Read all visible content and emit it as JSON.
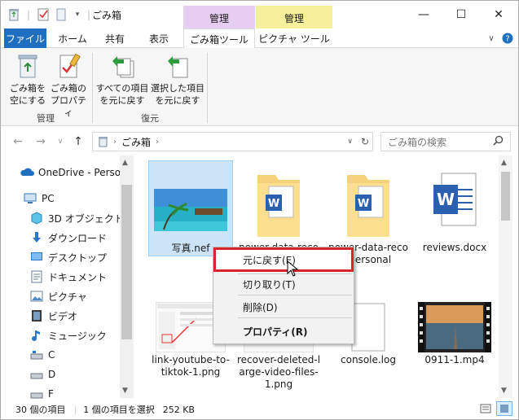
{
  "titlebar": {
    "title": "ごみ箱",
    "manage1": "管理",
    "manage2": "管理",
    "minimize": "—",
    "maximize": "☐",
    "close": "✕"
  },
  "tabs": {
    "file": "ファイル",
    "home": "ホーム",
    "share": "共有",
    "view": "表示",
    "recycle_tools": "ごみ箱ツール",
    "picture_tools": "ピクチャ ツール"
  },
  "ribbon": {
    "empty": [
      "ごみ箱を",
      "空にする"
    ],
    "props": [
      "ごみ箱の",
      "プロパティ"
    ],
    "restore_all": [
      "すべての項目",
      "を元に戻す"
    ],
    "restore_sel": [
      "選択した項目",
      "を元に戻す"
    ],
    "group_manage": "管理",
    "group_restore": "復元"
  },
  "address": {
    "path": "ごみ箱",
    "search_placeholder": "ごみ箱の検索"
  },
  "nav": {
    "onedrive": "OneDrive - Person",
    "pc": "PC",
    "objects3d": "3D オブジェクト",
    "downloads": "ダウンロード",
    "desktop": "デスクトップ",
    "documents": "ドキュメント",
    "pictures": "ピクチャ",
    "videos": "ビデオ",
    "music": "ミュージック",
    "c": "C",
    "d": "D",
    "f": "F"
  },
  "files": {
    "f1": "写真.nef",
    "f2": "power-data-reco",
    "f3a": "power-data-reco",
    "f3b": "-personal",
    "f4": "reviews.docx",
    "f5": [
      "link-youtube-to-",
      "tiktok-1.png"
    ],
    "f6": [
      "recover-deleted-l",
      "arge-video-files-",
      "1.png"
    ],
    "f7": "console.log",
    "f8": "0911-1.mp4"
  },
  "context_menu": {
    "restore": "元に戻す(E)",
    "cut": "切り取り(T)",
    "delete": "削除(D)",
    "properties": "プロパティ(R)"
  },
  "status": {
    "count": "30 個の項目",
    "selected": "1 個の項目を選択",
    "size": "252 KB"
  },
  "colors": {
    "file_tab": "#1e6fbf",
    "manage1_bg": "#e6cdf2",
    "manage2_bg": "#f5f09a",
    "selection": "#cce4f7",
    "highlight_box": "#d6262c"
  }
}
